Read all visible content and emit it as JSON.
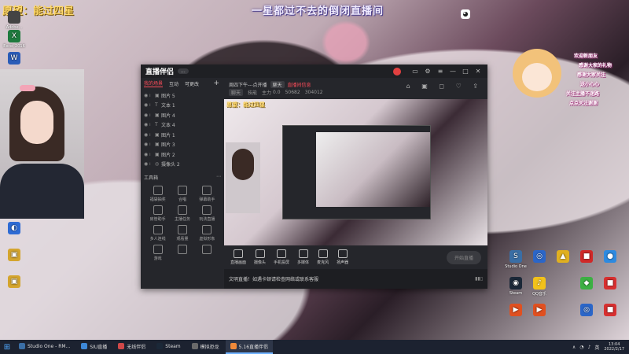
{
  "overlay": {
    "wish": "愿望：能过四星",
    "banner": "一星都过不去的倒闭直播间"
  },
  "desktop_left_icons": [
    {
      "label": "Adobe...",
      "color": "#444"
    },
    {
      "label": "Excel 2016",
      "color": "#1f7a3e"
    },
    {
      "label": "W",
      "color": "#2b5cb8"
    },
    {
      "label": "",
      "color": "#2e6bd4"
    },
    {
      "label": "",
      "color": "#d4a52e"
    },
    {
      "label": "",
      "color": "#d4a52e"
    }
  ],
  "stream_app": {
    "logo": "直播伴侣",
    "version": "...",
    "tabs": [
      "我的场景",
      "互动",
      "可更改"
    ],
    "plus": "+",
    "layers": [
      "图片 5",
      "文本 1",
      "图片 4",
      "文本 4",
      "图片 1",
      "图片 3",
      "图片 2",
      "摄像头 2"
    ],
    "toolbox_title": "工具箱",
    "tools": [
      "福袋抽奖",
      "合唱",
      "弹幕助手",
      "房管助手",
      "主播任务",
      "玩法直播",
      "多人连线",
      "观看量",
      "虚拟形象",
      "游戏",
      "",
      ""
    ],
    "info": {
      "line1": "周四下午---点开播",
      "tag1": "聊天",
      "red_link": "直播间信息",
      "line2_items": [
        "聊天",
        "技能",
        "主力",
        "0.0",
        "50682",
        "304012"
      ]
    },
    "preview_wish": "愿望：能过四星",
    "bottom_tools": [
      "直播画面",
      "摄像头",
      "手机投屏",
      "多媒体",
      "麦克风",
      "扬声器"
    ],
    "start_button": "开始直播",
    "status_text": "文明直播！如遇卡顿请检查网络或联系客服"
  },
  "taskbar": {
    "start_icon": "⊞",
    "tasks": [
      {
        "label": "Studio One - RM...",
        "color": "#3a6ea5",
        "active": false
      },
      {
        "label": "SIU直播",
        "color": "#3d88d8",
        "active": false
      },
      {
        "label": "无线伴侣",
        "color": "#d04848",
        "active": false
      },
      {
        "label": "Steam",
        "color": "#1b2838",
        "active": false
      },
      {
        "label": "模拟恐龙",
        "color": "#6a6a6a",
        "active": false
      },
      {
        "label": "5.16直播伴侣",
        "color": "#f08a3a",
        "active": true
      }
    ],
    "tray_items": [
      "∧",
      "◔",
      "♪",
      "英"
    ],
    "time": "13:04",
    "date": "2022/2/17"
  },
  "desktop_right_icons": [
    {
      "label": "Studio One",
      "color": "#3a6ea5"
    },
    {
      "label": "",
      "color": "#2b66c8"
    },
    {
      "label": "",
      "color": "#e0b020"
    },
    {
      "label": "",
      "color": "#d02828"
    },
    {
      "label": "",
      "color": "#2d8ae0"
    },
    {
      "label": "Steam",
      "color": "#1b2838"
    },
    {
      "label": "QQ音乐",
      "color": "#f2c21a"
    },
    {
      "label": "",
      "color": "#aaa"
    },
    {
      "label": "",
      "color": "#3cb043"
    },
    {
      "label": "",
      "color": "#d83030"
    },
    {
      "label": "",
      "color": "#e05020"
    },
    {
      "label": "",
      "color": "#e05020"
    },
    {
      "label": "",
      "color": "#aaa"
    },
    {
      "label": "",
      "color": "#2b66c8"
    },
    {
      "label": "",
      "color": "#d83030"
    }
  ],
  "chat_overlay": [
    {
      "text": "欢迎新朋友"
    },
    {
      "text": "感谢大家的礼物"
    },
    {
      "text": "感谢大家关注"
    },
    {
      "text": "送小心心"
    },
    {
      "text": "关注主播不迷路"
    },
    {
      "text": "点点关注谢谢"
    }
  ]
}
